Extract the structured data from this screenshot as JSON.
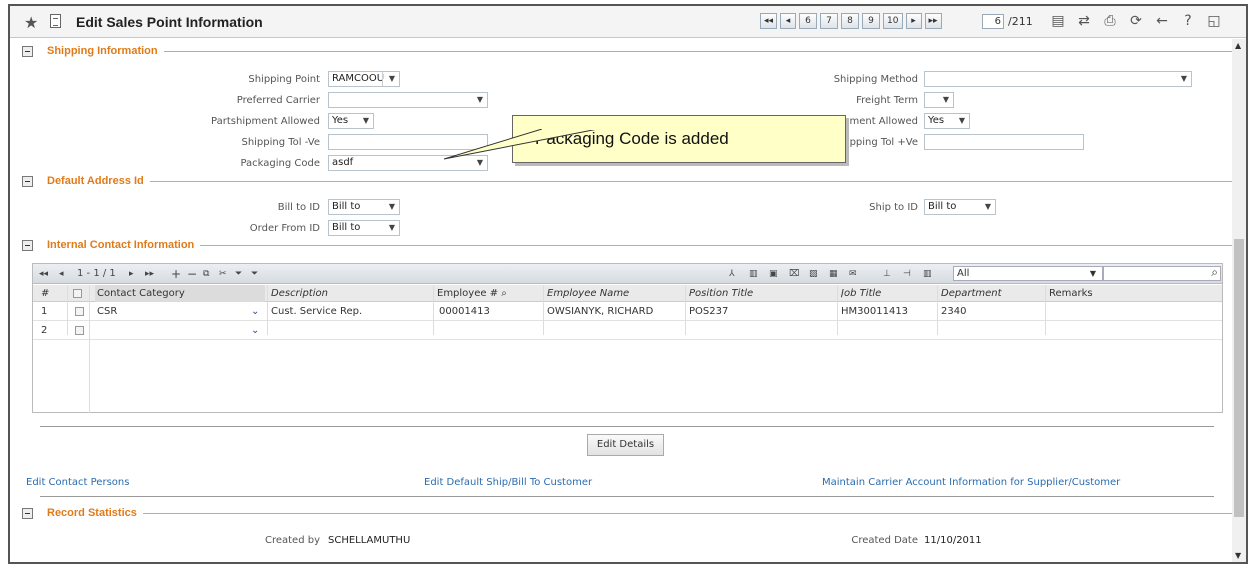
{
  "window": {
    "title": "Edit Sales Point Information"
  },
  "pager": {
    "first": "◂◂",
    "prev": "◂",
    "pages": [
      "6",
      "7",
      "8",
      "9",
      "10"
    ],
    "next": "▸",
    "last": "▸▸",
    "current": "6",
    "total": "/211"
  },
  "toolbar_icons": [
    "grid-icon",
    "shuffle-icon",
    "print-icon",
    "refresh-icon",
    "back-arrow-icon",
    "help-icon",
    "window-icon"
  ],
  "shipping": {
    "title": "Shipping Information",
    "shipping_point_label": "Shipping Point",
    "shipping_point_value": "RAMCOOU",
    "preferred_carrier_label": "Preferred Carrier",
    "preferred_carrier_value": "",
    "partshipment_label": "Partshipment Allowed",
    "partshipment_value": "Yes",
    "tol_neg_label": "Shipping Tol -Ve",
    "tol_neg_value": "",
    "packaging_label": "Packaging Code",
    "packaging_value": "asdf",
    "shipping_method_label": "Shipping Method",
    "shipping_method_value": "",
    "freight_term_label": "Freight Term",
    "freight_term_value": "",
    "shipment_allowed_label": "pment Allowed",
    "shipment_allowed_value": "Yes",
    "tol_pos_label": "hipping Tol +Ve",
    "tol_pos_value": ""
  },
  "callout": {
    "text": "Packaging Code is added"
  },
  "address": {
    "title": "Default Address Id",
    "bill_to_label": "Bill to ID",
    "bill_to_value": "Bill to",
    "order_from_label": "Order From ID",
    "order_from_value": "Bill to",
    "ship_to_label": "Ship to ID",
    "ship_to_value": "Bill to"
  },
  "contacts": {
    "title": "Internal Contact Information",
    "grid_pager": "1 - 1 / 1",
    "search_scope": "All",
    "headers": {
      "num": "#",
      "category": "Contact Category",
      "description": "Description",
      "employee_no": "Employee #",
      "employee_name": "Employee Name",
      "position": "Position Title",
      "job": "Job Title",
      "dept": "Department",
      "remarks": "Remarks"
    },
    "rows": [
      {
        "num": "1",
        "category": "CSR",
        "description": "Cust. Service Rep.",
        "employee_no": "00001413",
        "employee_name": "OWSIANYK, RICHARD",
        "position": "POS237",
        "job": "HM30011413",
        "dept": "2340",
        "remarks": ""
      },
      {
        "num": "2",
        "category": "",
        "description": "",
        "employee_no": "",
        "employee_name": "",
        "position": "",
        "job": "",
        "dept": "",
        "remarks": ""
      }
    ]
  },
  "actions": {
    "edit_details": "Edit Details",
    "link_contacts": "Edit Contact Persons",
    "link_ship_bill": "Edit Default Ship/Bill To Customer",
    "link_carrier": "Maintain Carrier Account Information for Supplier/Customer"
  },
  "stats": {
    "title": "Record Statistics",
    "created_by_label": "Created by",
    "created_by_value": "SCHELLAMUTHU",
    "created_date_label": "Created Date",
    "created_date_value": "11/10/2011"
  }
}
